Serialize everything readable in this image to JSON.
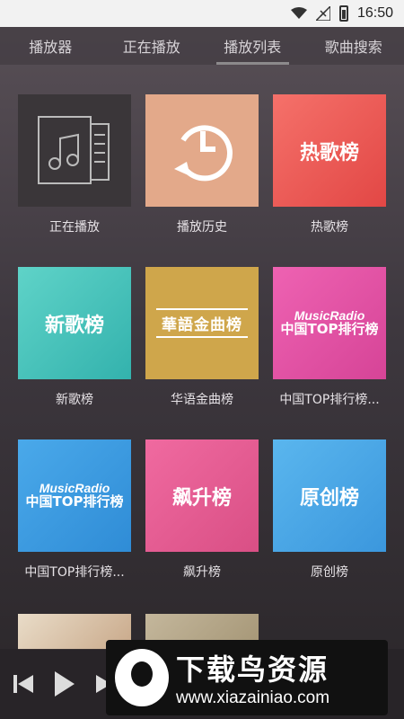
{
  "status": {
    "time": "16:50",
    "icons": [
      "wifi-icon",
      "signal-icon",
      "battery-icon"
    ]
  },
  "tabs": [
    {
      "label": "播放器"
    },
    {
      "label": "正在播放"
    },
    {
      "label": "播放列表",
      "active": true
    },
    {
      "label": "歌曲搜索"
    }
  ],
  "tiles": [
    {
      "caption": "正在播放",
      "icon": "music-document-icon",
      "color": "#3a3639"
    },
    {
      "caption": "播放历史",
      "icon": "history-icon",
      "color": "#e3a98a"
    },
    {
      "caption": "热歌榜",
      "text": "热歌榜",
      "color": "#ef5f5a"
    },
    {
      "caption": "新歌榜",
      "text": "新歌榜",
      "color": "#46c4bb"
    },
    {
      "caption": "华语金曲榜",
      "text": "華語金曲榜",
      "color": "#cfa64b"
    },
    {
      "caption": "中国TOP排行榜...",
      "logo_line1": "MusicRadio",
      "logo_line2": "中国TOP排行榜",
      "color": "#e352a3"
    },
    {
      "caption": "中国TOP排行榜...",
      "logo_line1": "MusicRadio",
      "logo_line2": "中国TOP排行榜",
      "color": "#3b9be0"
    },
    {
      "caption": "飙升榜",
      "text": "飙升榜",
      "color": "#e65c92"
    },
    {
      "caption": "原创榜",
      "text": "原创榜",
      "color": "#4aa7e6"
    }
  ],
  "player": {
    "buttons": [
      "previous-icon",
      "play-icon",
      "next-icon"
    ]
  },
  "watermark": {
    "cn": "下载鸟资源",
    "en": "www.xiazainiao.com"
  }
}
